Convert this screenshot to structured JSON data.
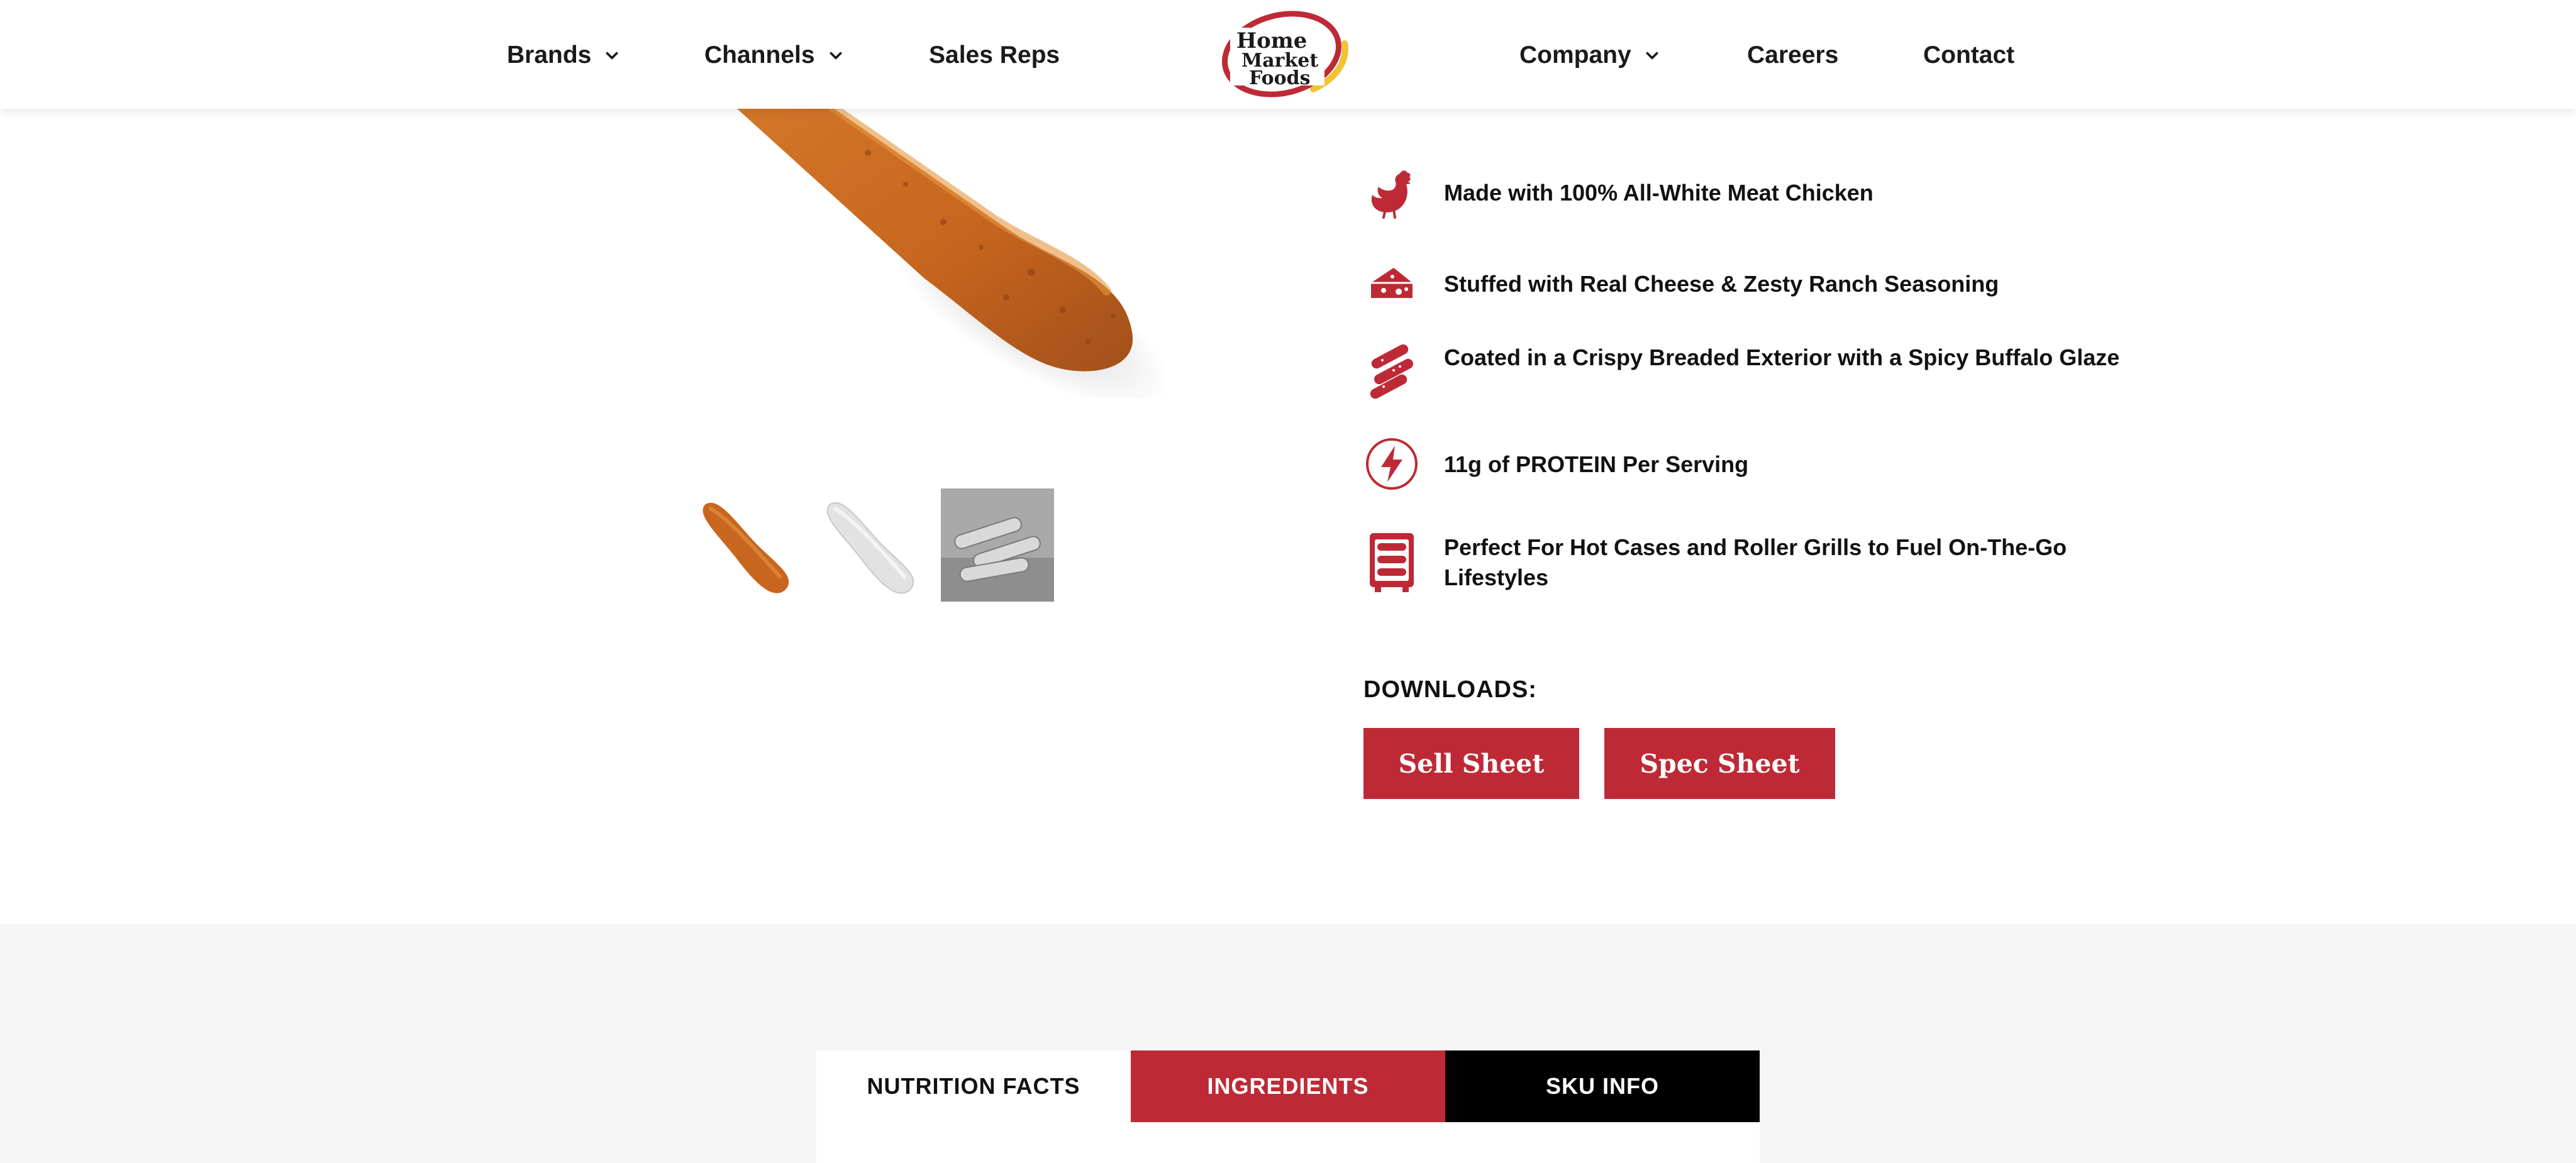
{
  "header": {
    "nav_left": [
      {
        "label": "Brands",
        "has_dropdown": true
      },
      {
        "label": "Channels",
        "has_dropdown": true
      },
      {
        "label": "Sales Reps",
        "has_dropdown": false
      }
    ],
    "logo_text": [
      "Home",
      "Market",
      "Foods"
    ],
    "nav_right": [
      {
        "label": "Company",
        "has_dropdown": true
      },
      {
        "label": "Careers",
        "has_dropdown": false
      },
      {
        "label": "Contact",
        "has_dropdown": false
      }
    ]
  },
  "features": [
    {
      "icon": "chicken-icon",
      "text": "Made with 100% All-White Meat Chicken"
    },
    {
      "icon": "cheese-icon",
      "text": "Stuffed with Real Cheese & Zesty Ranch Seasoning"
    },
    {
      "icon": "breaded-sticks-icon",
      "text": "Coated in a Crispy Breaded Exterior with a Spicy Buffalo Glaze"
    },
    {
      "icon": "lightning-bolt-icon",
      "text": "11g of PROTEIN Per Serving"
    },
    {
      "icon": "roller-grill-icon",
      "text": "Perfect For Hot Cases and Roller Grills to Fuel On-The-Go Lifestyles"
    }
  ],
  "downloads": {
    "label": "DOWNLOADS:",
    "buttons": [
      "Sell Sheet",
      "Spec Sheet"
    ]
  },
  "tabs": [
    "NUTRITION FACTS",
    "INGREDIENTS",
    "SKU INFO"
  ],
  "colors": {
    "brand_red": "#bd2a36",
    "black": "#000000",
    "lower_bg": "#f5f5f5"
  }
}
